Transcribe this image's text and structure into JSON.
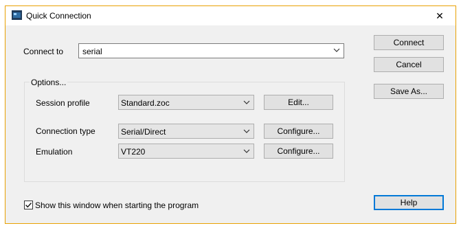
{
  "window": {
    "title": "Quick Connection",
    "close_glyph": "✕"
  },
  "connect_to": {
    "label": "Connect to",
    "value": "serial"
  },
  "options": {
    "group_label": "Options...",
    "session_profile": {
      "label": "Session profile",
      "value": "Standard.zoc",
      "button": "Edit..."
    },
    "connection_type": {
      "label": "Connection type",
      "value": "Serial/Direct",
      "button": "Configure..."
    },
    "emulation": {
      "label": "Emulation",
      "value": "VT220",
      "button": "Configure..."
    }
  },
  "buttons": {
    "connect": "Connect",
    "cancel": "Cancel",
    "save_as": "Save As...",
    "help": "Help"
  },
  "show_window": {
    "label": "Show this window when starting the program",
    "checked": true
  },
  "colors": {
    "accent": "#0078d7",
    "window_border": "#e8a000",
    "face": "#f0f0f0"
  }
}
